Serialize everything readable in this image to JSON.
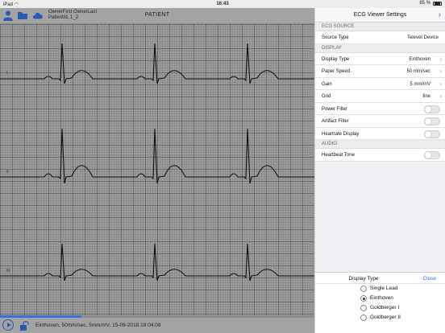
{
  "statusbar": {
    "device": "iPad",
    "wifi_icon": "wifi-icon",
    "time": "16:43",
    "battery": "85 %"
  },
  "ecg": {
    "patient_name": "OwnerFirst OwnerLast",
    "patient_id": "PatientId, 1_2",
    "title": "PATIENT",
    "leads": [
      "I",
      "II",
      "III"
    ],
    "progress": 0.26,
    "footer_text": "Einthoven, 50mm/sec, 5mm/mV, 15-09-2018 18:04:08"
  },
  "panel": {
    "title": "ECG Viewer Settings",
    "sections": {
      "source_title": "ECG SOURCE",
      "display_title": "DISPLAY",
      "audio_title": "AUDIO"
    },
    "source": {
      "label": "Source Type",
      "value": "Televet Device"
    },
    "display": {
      "display_type": {
        "label": "Display Type",
        "value": "Einthoven"
      },
      "paper_speed": {
        "label": "Paper Speed",
        "value": "50 mm/sec"
      },
      "gain": {
        "label": "Gain",
        "value": "5 mm/mV"
      },
      "grid": {
        "label": "Grid",
        "value": "fine"
      },
      "power_filter": {
        "label": "Power Filter",
        "on": false
      },
      "artifact_filter": {
        "label": "Artifact Filter",
        "on": false
      },
      "heartrate_display": {
        "label": "Heartrate Display",
        "on": false
      }
    },
    "audio": {
      "heartbeat_tone": {
        "label": "Heartbeat Tone",
        "on": false
      }
    },
    "picker": {
      "title": "Display Type",
      "close": "Close",
      "options": [
        {
          "label": "Single Lead",
          "selected": false
        },
        {
          "label": "Einthoven",
          "selected": true
        },
        {
          "label": "Goldberger I",
          "selected": false
        },
        {
          "label": "Goldberger II",
          "selected": false
        }
      ]
    }
  },
  "colors": {
    "accent": "#2a6de0",
    "grid_bg": "#9c9c9c",
    "trace": "#111111"
  }
}
